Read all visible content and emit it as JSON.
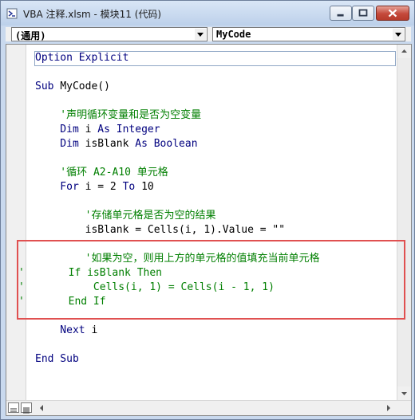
{
  "window": {
    "title": "VBA 注释.xlsm - 模块11 (代码)"
  },
  "combos": {
    "object_value": "(通用)",
    "procedure_value": "MyCode"
  },
  "code_lines": [
    {
      "segments": [
        {
          "t": "kw",
          "s": "Option Explicit"
        }
      ]
    },
    {
      "segments": []
    },
    {
      "segments": [
        {
          "t": "kw",
          "s": "Sub "
        },
        {
          "t": "tx",
          "s": "MyCode()"
        }
      ]
    },
    {
      "segments": []
    },
    {
      "segments": [
        {
          "t": "cm",
          "s": "    '声明循环变量和是否为空变量"
        }
      ]
    },
    {
      "segments": [
        {
          "t": "kw",
          "s": "    Dim "
        },
        {
          "t": "tx",
          "s": "i "
        },
        {
          "t": "kw",
          "s": "As Integer"
        }
      ]
    },
    {
      "segments": [
        {
          "t": "kw",
          "s": "    Dim "
        },
        {
          "t": "tx",
          "s": "isBlank "
        },
        {
          "t": "kw",
          "s": "As Boolean"
        }
      ]
    },
    {
      "segments": []
    },
    {
      "segments": [
        {
          "t": "cm",
          "s": "    '循环 A2-A10 单元格"
        }
      ]
    },
    {
      "segments": [
        {
          "t": "kw",
          "s": "    For "
        },
        {
          "t": "tx",
          "s": "i = 2 "
        },
        {
          "t": "kw",
          "s": "To "
        },
        {
          "t": "tx",
          "s": "10"
        }
      ]
    },
    {
      "segments": []
    },
    {
      "segments": [
        {
          "t": "cm",
          "s": "        '存储单元格是否为空的结果"
        }
      ]
    },
    {
      "segments": [
        {
          "t": "tx",
          "s": "        isBlank = Cells(i, 1).Value = \"\""
        }
      ]
    },
    {
      "segments": []
    },
    {
      "segments": [
        {
          "t": "cm",
          "s": "        '如果为空，则用上方的单元格的值填充当前单元格"
        }
      ]
    },
    {
      "segments": [
        {
          "t": "cm",
          "s": "'       If isBlank Then"
        }
      ]
    },
    {
      "segments": [
        {
          "t": "cm",
          "s": "'           Cells(i, 1) = Cells(i - 1, 1)"
        }
      ]
    },
    {
      "segments": [
        {
          "t": "cm",
          "s": "'       End If"
        }
      ]
    },
    {
      "segments": []
    },
    {
      "segments": [
        {
          "t": "kw",
          "s": "    Next "
        },
        {
          "t": "tx",
          "s": "i"
        }
      ]
    },
    {
      "segments": []
    },
    {
      "segments": [
        {
          "t": "kw",
          "s": "End Sub"
        }
      ]
    }
  ]
}
